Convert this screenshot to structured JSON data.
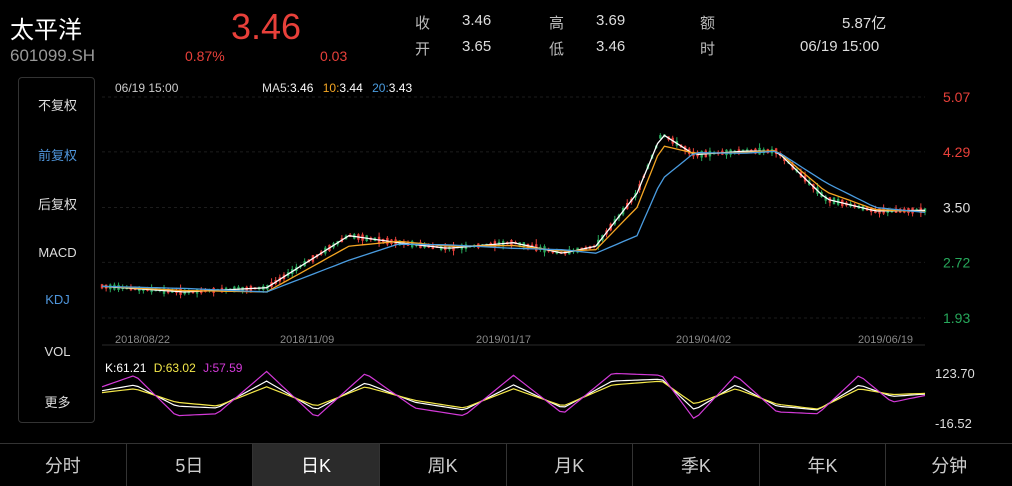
{
  "stock": {
    "name": "太平洋",
    "code": "601099.SH",
    "price": "3.46",
    "change_pct": "0.87%",
    "change": "0.03"
  },
  "quote": {
    "close_label": "收",
    "close": "3.46",
    "open_label": "开",
    "open": "3.65",
    "high_label": "高",
    "high": "3.69",
    "low_label": "低",
    "low": "3.46",
    "amount_label": "额",
    "amount": "5.87亿",
    "time_label": "时",
    "time": "06/19 15:00"
  },
  "sidebar": {
    "items": [
      "不复权",
      "前复权",
      "后复权",
      "MACD",
      "KDJ",
      "VOL",
      "更多"
    ]
  },
  "chart_info": {
    "time": "06/19 15:00",
    "ma5_label": "MA5:",
    "ma5": "3.46",
    "ma10_label": "10:",
    "ma10": "3.44",
    "ma20_label": "20:",
    "ma20": "3.43",
    "k_label": "K:",
    "k": "61.21",
    "d_label": "D:",
    "d": "63.02",
    "j_label": "J:",
    "j": "57.59"
  },
  "tabs": [
    "分时",
    "5日",
    "日K",
    "周K",
    "月K",
    "季K",
    "年K",
    "分钟"
  ],
  "colors": {
    "up": "#e8403a",
    "down": "#27a85b",
    "ma5": "#ffffff",
    "ma10": "#f5a623",
    "ma20": "#4a9ce0",
    "k": "#ffffff",
    "d": "#f4e84a",
    "j": "#d43ad9",
    "accent": "#4f96dc"
  },
  "chart_data": [
    {
      "type": "line",
      "title": "",
      "y_ticks": [
        "5.07",
        "4.29",
        "3.50",
        "2.72",
        "1.93"
      ],
      "y_tick_values": [
        5.07,
        4.29,
        3.5,
        2.72,
        1.93
      ],
      "ylim": [
        1.93,
        5.07
      ],
      "x_ticks": [
        "2018/08/22",
        "2018/11/09",
        "2019/01/17",
        "2019/04/02",
        "2019/06/19"
      ],
      "series": [
        {
          "name": "MA5",
          "x": [
            0,
            0.1,
            0.2,
            0.3,
            0.36,
            0.42,
            0.5,
            0.56,
            0.6,
            0.65,
            0.68,
            0.72,
            0.78,
            0.82,
            0.88,
            0.94,
            1
          ],
          "values": [
            2.38,
            2.3,
            2.36,
            3.1,
            3.0,
            2.92,
            3.0,
            2.85,
            2.95,
            3.7,
            4.55,
            4.25,
            4.3,
            4.3,
            3.62,
            3.45,
            3.46
          ]
        },
        {
          "name": "10",
          "x": [
            0,
            0.1,
            0.2,
            0.3,
            0.36,
            0.42,
            0.5,
            0.56,
            0.6,
            0.65,
            0.68,
            0.72,
            0.78,
            0.82,
            0.88,
            0.94,
            1
          ],
          "values": [
            2.38,
            2.32,
            2.3,
            2.95,
            3.02,
            2.95,
            2.96,
            2.88,
            2.9,
            3.5,
            4.38,
            4.27,
            4.28,
            4.31,
            3.72,
            3.47,
            3.44
          ]
        },
        {
          "name": "20",
          "x": [
            0,
            0.1,
            0.2,
            0.3,
            0.36,
            0.42,
            0.5,
            0.56,
            0.6,
            0.65,
            0.68,
            0.72,
            0.78,
            0.82,
            0.88,
            0.94,
            1
          ],
          "values": [
            2.38,
            2.35,
            2.3,
            2.75,
            2.98,
            2.97,
            2.92,
            2.9,
            2.85,
            3.1,
            3.9,
            4.28,
            4.27,
            4.3,
            3.85,
            3.5,
            3.43
          ]
        }
      ]
    },
    {
      "type": "line",
      "title": "",
      "y_ticks": [
        "123.70",
        "-16.52"
      ],
      "ylim": [
        -16.52,
        123.7
      ],
      "series": [
        {
          "name": "K",
          "x": [
            0,
            0.04,
            0.09,
            0.14,
            0.2,
            0.26,
            0.32,
            0.38,
            0.44,
            0.5,
            0.56,
            0.62,
            0.68,
            0.72,
            0.77,
            0.82,
            0.87,
            0.92,
            0.96,
            1
          ],
          "values": [
            70,
            85,
            30,
            25,
            95,
            20,
            90,
            40,
            20,
            85,
            25,
            95,
            100,
            20,
            85,
            30,
            20,
            85,
            55,
            61.21
          ]
        },
        {
          "name": "D",
          "x": [
            0,
            0.04,
            0.09,
            0.14,
            0.2,
            0.26,
            0.32,
            0.38,
            0.44,
            0.5,
            0.56,
            0.62,
            0.68,
            0.72,
            0.77,
            0.82,
            0.87,
            0.92,
            0.96,
            1
          ],
          "values": [
            65,
            75,
            40,
            30,
            80,
            30,
            80,
            45,
            25,
            75,
            30,
            85,
            95,
            35,
            75,
            35,
            22,
            75,
            60,
            63.02
          ]
        },
        {
          "name": "J",
          "x": [
            0,
            0.04,
            0.09,
            0.14,
            0.2,
            0.26,
            0.32,
            0.38,
            0.44,
            0.5,
            0.56,
            0.62,
            0.68,
            0.72,
            0.77,
            0.82,
            0.87,
            0.92,
            0.96,
            1
          ],
          "values": [
            80,
            110,
            5,
            10,
            120,
            0,
            115,
            25,
            5,
            110,
            10,
            115,
            110,
            -5,
            110,
            15,
            10,
            110,
            40,
            57.59
          ]
        }
      ]
    }
  ]
}
